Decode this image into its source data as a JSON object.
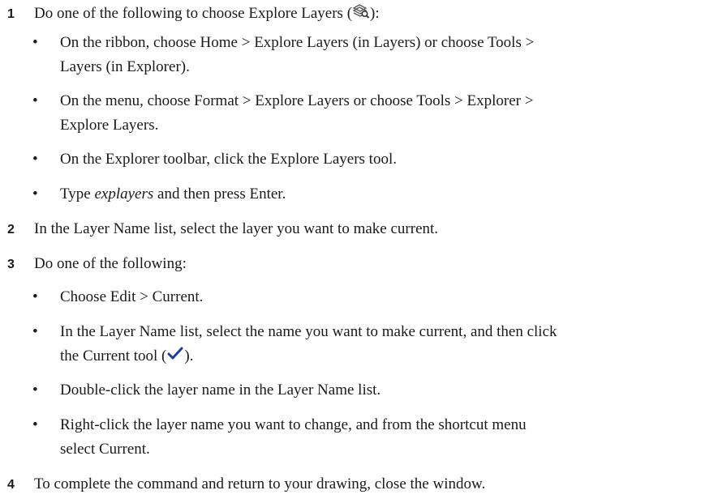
{
  "step1": {
    "number": "1",
    "text_before": "Do one of the following to choose Explore Layers (",
    "text_after": "):",
    "icon": "explore-layers-icon",
    "bullets": [
      {
        "line1": "On the ribbon, choose Home > Explore Layers (in Layers) or choose Tools >",
        "line2": "Layers (in Explorer)."
      },
      {
        "line1": "On the menu, choose Format > Explore Layers or choose Tools > Explorer >",
        "line2": "Explore Layers."
      },
      {
        "line1": "On the Explorer toolbar, click the Explore Layers tool."
      },
      {
        "text_before": "Type ",
        "emphasis": "explayers",
        "text_after": " and then press Enter."
      }
    ]
  },
  "step2": {
    "number": "2",
    "text": "In the Layer Name list, select the layer you want to make current."
  },
  "step3": {
    "number": "3",
    "text": "Do one of the following:",
    "bullets": [
      {
        "line1": "Choose Edit > Current."
      },
      {
        "line1": "In the Layer Name list, select the name you want to make current, and then click",
        "line2_before": "the Current tool (",
        "line2_after": ").",
        "icon": "checkmark-icon"
      },
      {
        "line1": "Double-click the layer name in the Layer Name list."
      },
      {
        "line1": "Right-click the layer name you want to change, and from the shortcut menu",
        "line2": "select Current."
      }
    ]
  },
  "step4": {
    "number": "4",
    "text": "To complete the command and return to your drawing, close the window."
  },
  "colors": {
    "icon_blue": "#1f3f8f",
    "text": "#1a1a1a"
  }
}
